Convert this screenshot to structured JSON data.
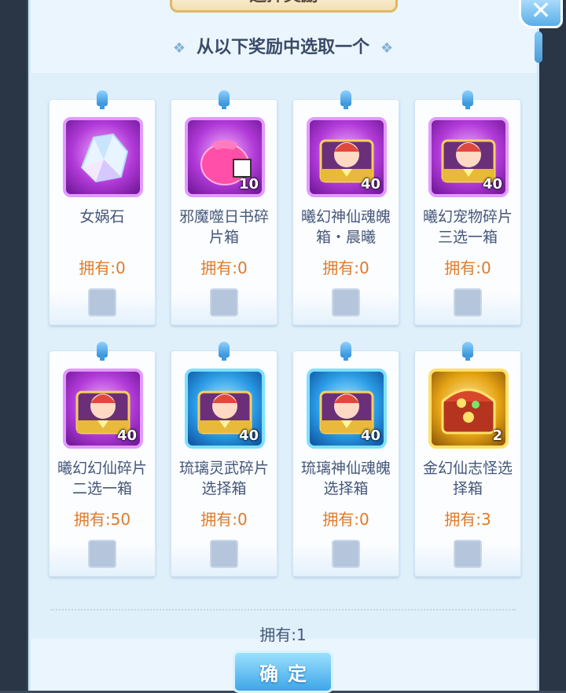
{
  "window": {
    "title": "选择奖励",
    "close_icon": "close-icon"
  },
  "header": {
    "subtitle": "从以下奖励中选取一个",
    "deco_glyph": "❖"
  },
  "rewards": [
    {
      "name": "女娲石",
      "owned": "拥有:0",
      "count": "",
      "frame": "purple",
      "icon": "crystal-icon"
    },
    {
      "name": "邪魔噬日书碎片箱",
      "owned": "拥有:0",
      "count": "10",
      "frame": "purple",
      "icon": "pouch-icon"
    },
    {
      "name": "曦幻神仙魂魄箱・晨曦",
      "owned": "拥有:0",
      "count": "40",
      "frame": "purple",
      "icon": "chest-icon"
    },
    {
      "name": "曦幻宠物碎片三选一箱",
      "owned": "拥有:0",
      "count": "40",
      "frame": "purple",
      "icon": "chest-icon"
    },
    {
      "name": "曦幻幻仙碎片二选一箱",
      "owned": "拥有:50",
      "count": "40",
      "frame": "purple",
      "icon": "chest-icon"
    },
    {
      "name": "琉璃灵武碎片选择箱",
      "owned": "拥有:0",
      "count": "40",
      "frame": "blue",
      "icon": "chest-icon"
    },
    {
      "name": "琉璃神仙魂魄选择箱",
      "owned": "拥有:0",
      "count": "40",
      "frame": "blue",
      "icon": "chest-icon"
    },
    {
      "name": "金幻仙志怪选择箱",
      "owned": "拥有:3",
      "count": "2",
      "frame": "gold",
      "icon": "treasure-chest-icon"
    }
  ],
  "footer": {
    "total_owned": "拥有:1",
    "confirm_label": "确定"
  },
  "colors": {
    "owned_text": "#e07b2a",
    "name_text": "#46577a",
    "button_blue": "#3ea6e8"
  }
}
